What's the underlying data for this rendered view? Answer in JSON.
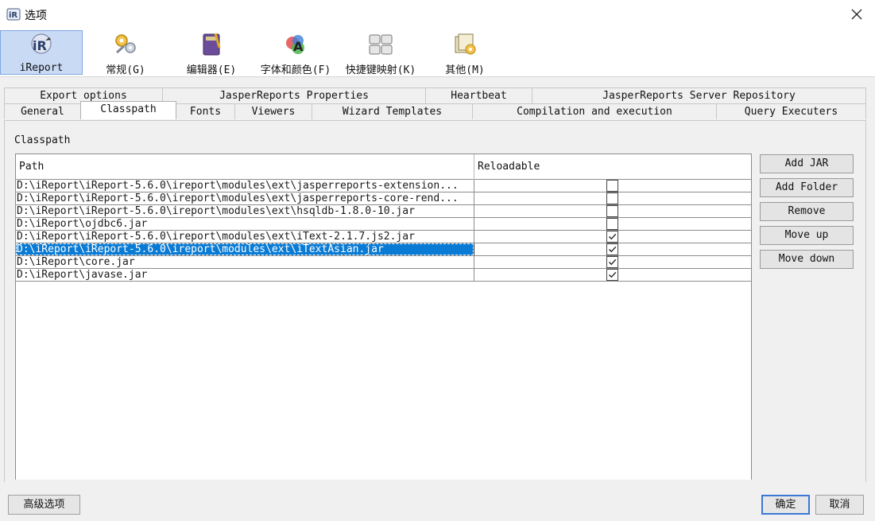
{
  "window": {
    "title": "选项"
  },
  "categories": [
    {
      "label": "iReport",
      "icon": "ireport-icon",
      "selected": true
    },
    {
      "label": "常规(G)",
      "icon": "gears-icon"
    },
    {
      "label": "编辑器(E)",
      "icon": "book-icon"
    },
    {
      "label": "字体和颜色(F)",
      "icon": "font-color-icon"
    },
    {
      "label": "快捷键映射(K)",
      "icon": "keyboard-icon"
    },
    {
      "label": "其他(M)",
      "icon": "misc-icon"
    }
  ],
  "tabs": {
    "row1": [
      "Export options",
      "JasperReports Properties",
      "Heartbeat",
      "JasperReports Server Repository"
    ],
    "row2": [
      "General",
      "Classpath",
      "Fonts",
      "Viewers",
      "Wizard Templates",
      "Compilation and execution",
      "Query Executers"
    ],
    "active": "Classpath"
  },
  "classpath": {
    "section_label": "Classpath",
    "columns": {
      "path": "Path",
      "reloadable": "Reloadable"
    },
    "rows": [
      {
        "path": "D:\\iReport\\iReport-5.6.0\\ireport\\modules\\ext\\jasperreports-extension...",
        "reloadable": false
      },
      {
        "path": "D:\\iReport\\iReport-5.6.0\\ireport\\modules\\ext\\jasperreports-core-rend...",
        "reloadable": false
      },
      {
        "path": "D:\\iReport\\iReport-5.6.0\\ireport\\modules\\ext\\hsqldb-1.8.0-10.jar",
        "reloadable": false
      },
      {
        "path": "D:\\iReport\\ojdbc6.jar",
        "reloadable": false
      },
      {
        "path": "D:\\iReport\\iReport-5.6.0\\ireport\\modules\\ext\\iText-2.1.7.js2.jar",
        "reloadable": true
      },
      {
        "path": "D:\\iReport\\iReport-5.6.0\\ireport\\modules\\ext\\iTextAsian.jar",
        "reloadable": true,
        "selected": true
      },
      {
        "path": "D:\\iReport\\core.jar",
        "reloadable": true
      },
      {
        "path": "D:\\iReport\\javase.jar",
        "reloadable": true
      }
    ],
    "buttons": {
      "add_jar": "Add JAR",
      "add_folder": "Add Folder",
      "remove": "Remove",
      "move_up": "Move up",
      "move_down": "Move down"
    }
  },
  "footer": {
    "advanced": "高级选项",
    "ok": "确定",
    "cancel": "取消"
  },
  "colors": {
    "selection": "#0a7bd4",
    "category_selected": "#c9daf5"
  }
}
